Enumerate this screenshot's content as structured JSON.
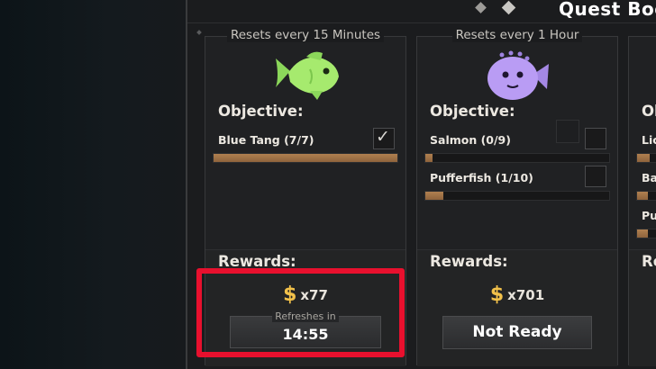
{
  "book": {
    "title": "Quest Boo"
  },
  "quests": [
    {
      "reset_text": "Resets every 15 Minutes",
      "icon": "green-fish-icon",
      "objective_label": "Objective:",
      "objectives": [
        {
          "name": "Blue Tang (7/7)",
          "progress": 1.0,
          "completed": true
        }
      ],
      "rewards_label": "Rewards:",
      "reward_amount": "x77",
      "refresh_caption": "Refreshes in",
      "refresh_time": "14:55"
    },
    {
      "reset_text": "Resets every 1 Hour",
      "icon": "purple-pufferfish-icon",
      "objective_label": "Objective:",
      "objectives": [
        {
          "name": "Salmon (0/9)",
          "progress": 0.0,
          "completed": false
        },
        {
          "name": "Pufferfish (1/10)",
          "progress": 0.1,
          "completed": false
        }
      ],
      "rewards_label": "Rewards:",
      "reward_amount": "x701",
      "button_label": "Not Ready"
    },
    {
      "objective_label": "Ol",
      "objectives": [
        {
          "name": "Lic"
        },
        {
          "name": "Ba"
        },
        {
          "name": "Pu"
        }
      ],
      "rewards_label": "Re"
    }
  ],
  "colors": {
    "highlight": "#e8102e",
    "coin": "#f2c14a",
    "progress_fill": "#a87a4a",
    "green_fish": "#9fe36a",
    "purple_fish": "#b79af2"
  }
}
